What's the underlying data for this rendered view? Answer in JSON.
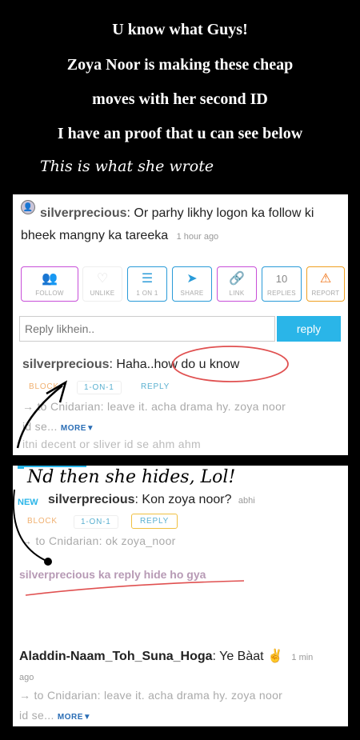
{
  "captions": [
    "U know what Guys!",
    "Zoya Noor is making these cheap",
    "moves with her second ID",
    "I have an proof  that u can see below"
  ],
  "handwritten": {
    "wrote": "This is what she wrote",
    "hides": "Nd then she hides, Lol!"
  },
  "post": {
    "username": "silverprecious",
    "message": ": Or parhy likhy logon ka follow ki bheek mangny ka tareeka",
    "time": "1 hour ago"
  },
  "actions": [
    {
      "icon": "follow-icon",
      "glyph": "👥",
      "label": "FOLLOW",
      "color": "#c84fd8"
    },
    {
      "icon": "heart-icon",
      "glyph": "♡",
      "label": "UNLIKE",
      "color": "#e9e9e9"
    },
    {
      "icon": "chat-icon",
      "glyph": "☰",
      "label": "1 ON 1",
      "color": "#2a9bd8"
    },
    {
      "icon": "share-icon",
      "glyph": "➤",
      "label": "SHARE",
      "color": "#2a9bd8"
    },
    {
      "icon": "link-icon",
      "glyph": "🔗",
      "label": "LINK",
      "color": "#c84fd8"
    },
    {
      "icon": "replies-count",
      "glyph": "10",
      "label": "REPLIES",
      "color": "#2a9bd8"
    },
    {
      "icon": "warning-icon",
      "glyph": "⚠",
      "label": "REPORT",
      "color": "#f0a020"
    }
  ],
  "reply_box": {
    "placeholder": "Reply likhein..",
    "button": "reply"
  },
  "reply1": {
    "username": "silverprecious",
    "message": ": Haha..how do u know",
    "block": "BLOCK",
    "oneonone": "1-ON-1",
    "reply": "REPLY",
    "to_line": "→ to Cnidarian: leave it. acha drama hy. zoya noor",
    "to_line2": "id se...",
    "more": "MORE▼",
    "faded": "itni decent or sliver id se ahm ahm"
  },
  "reply2": {
    "new_badge": "NEW",
    "username": "silverprecious",
    "message": ": Kon zoya noor?",
    "time": "abhi",
    "block": "BLOCK",
    "oneonone": "1-ON-1",
    "reply": "REPLY",
    "to_line": "→ to Cnidarian: ok zoya_noor",
    "hidden": "silverprecious ka reply hide ho gya"
  },
  "reply3": {
    "username": "Aladdin-Naam_Toh_Suna_Hoga",
    "message": ": Ye Bàat ✌️",
    "time": "1 min",
    "time2": "ago",
    "to_line": "→ to Cnidarian: leave it. acha drama hy. zoya noor",
    "to_line2": "id se...",
    "more": "MORE▼"
  },
  "colors": {
    "accent": "#2ab5e8",
    "annotation": "#e05050"
  }
}
